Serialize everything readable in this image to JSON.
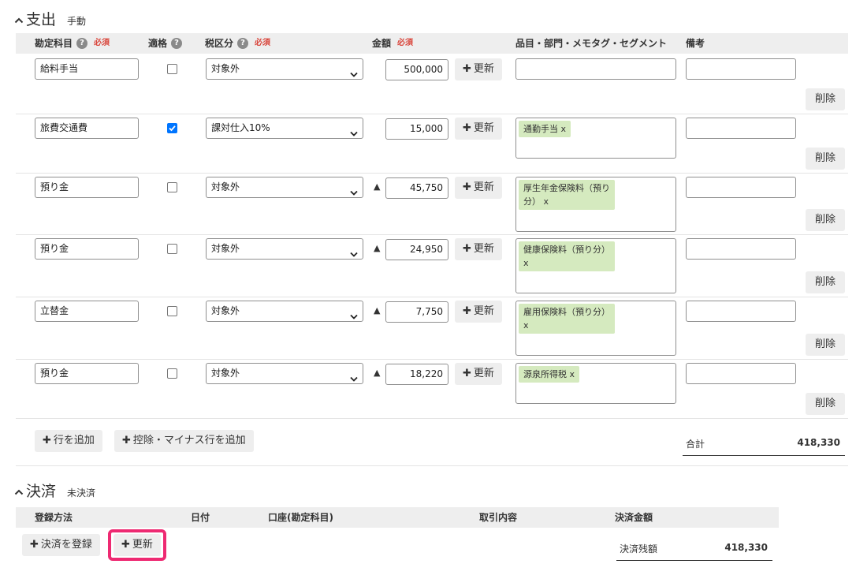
{
  "expense": {
    "title": "支出",
    "subtitle": "手動",
    "headers": {
      "account": "勘定科目",
      "qualified": "適格",
      "tax": "税区分",
      "amount": "金額",
      "item": "品目・部門・メモタグ・セグメント",
      "remarks": "備考",
      "required": "必須",
      "help": "?"
    },
    "rows": [
      {
        "account": "給料手当",
        "qualified": false,
        "tax": "対象外",
        "minus": false,
        "amount": "500,000",
        "tag": ""
      },
      {
        "account": "旅費交通費",
        "qualified": true,
        "tax": "課対仕入10%",
        "minus": false,
        "amount": "15,000",
        "tag": "通勤手当 x"
      },
      {
        "account": "預り金",
        "qualified": false,
        "tax": "対象外",
        "minus": true,
        "amount": "45,750",
        "tag": "厚生年金保険料（預り分） x"
      },
      {
        "account": "預り金",
        "qualified": false,
        "tax": "対象外",
        "minus": true,
        "amount": "24,950",
        "tag": "健康保険料（預り分） x"
      },
      {
        "account": "立替金",
        "qualified": false,
        "tax": "対象外",
        "minus": true,
        "amount": "7,750",
        "tag": "雇用保険料（預り分） x"
      },
      {
        "account": "預り金",
        "qualified": false,
        "tax": "対象外",
        "minus": true,
        "amount": "18,220",
        "tag": "源泉所得税 x"
      }
    ],
    "minus_mark": "▲",
    "update_label": "更新",
    "plus": "✚",
    "delete_label": "削除",
    "add_row_label": "行を追加",
    "add_minus_row_label": "控除・マイナス行を追加",
    "total_label": "合計",
    "total_value": "418,330"
  },
  "settlement": {
    "title": "決済",
    "subtitle": "未決済",
    "headers": {
      "method": "登録方法",
      "date": "日付",
      "account": "口座(勘定科目)",
      "content": "取引内容",
      "amount": "決済金額"
    },
    "register_label": "決済を登録",
    "update_label": "更新",
    "balance_label": "決済残額",
    "balance_value": "418,330"
  },
  "colors": {
    "accent_highlight": "#ee2a72",
    "required": "#d9453b",
    "tag_bg": "#d5eabf",
    "checkbox_on": "#0075ff"
  }
}
